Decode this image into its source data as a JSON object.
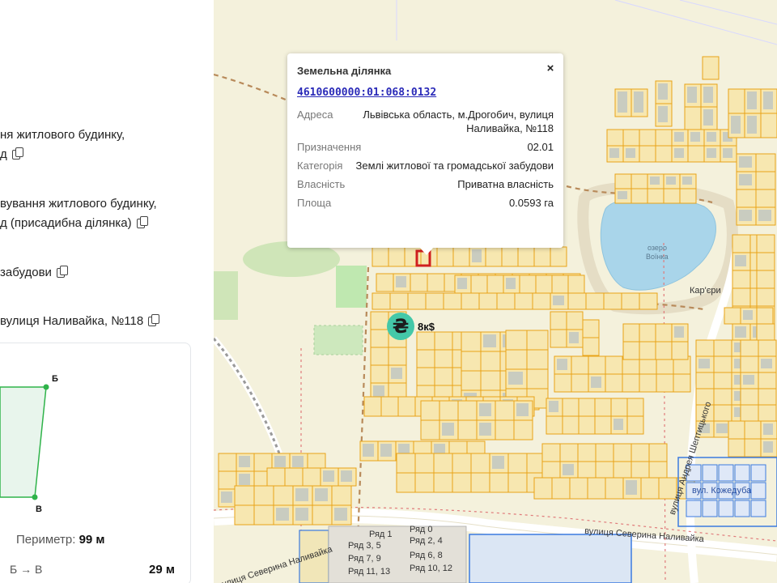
{
  "panel": {
    "line1a": "ня житлового будинку,",
    "line1b": "д",
    "line2a": "вування житлового будинку,",
    "line2b": "д (присадибна ділянка)",
    "line3": "забудови",
    "line4": " вулиця Наливайка, №118",
    "corner_b": "Б",
    "corner_v": "В",
    "perimeter_label": "Периметр:",
    "perimeter_value": "99 м",
    "segment_label": "Б → В",
    "segment_value": "29 м"
  },
  "popup": {
    "title": "Земельна ділянка",
    "close": "×",
    "cadastral": "4610600000:01:068:0132",
    "rows": [
      {
        "key": "Адреса",
        "value": "Львівська область, м.Дрогобич, вулиця Наливайка, №118"
      },
      {
        "key": "Призначення",
        "value": "02.01"
      },
      {
        "key": "Категорія",
        "value": "Землі житлової та громадської забудови"
      },
      {
        "key": "Власність",
        "value": "Приватна власність"
      },
      {
        "key": "Площа",
        "value": "0.0593 га"
      }
    ]
  },
  "pin": {
    "symbol": "₴",
    "price": "8к$"
  },
  "map_labels": {
    "lake": "озеро",
    "lake2": "Воїнка",
    "karery": "Кар'єри",
    "street1": "вулиця Северина Наливайка",
    "street2": "вулиця Северина Наливайка",
    "street3": "вулиця Андрея Шептицького",
    "rows": [
      "Ряд 0",
      "Ряд 1",
      "Ряд 2, 4",
      "Ряд 3, 5",
      "Ряд 6, 8",
      "Ряд 7, 9",
      "Ряд 10, 12",
      "Ряд 11, 13"
    ],
    "kozhedub": "вул. Кожедуба"
  },
  "colors": {
    "parcel_border": "#e8a317",
    "parcel_fill": "#f7e7b0",
    "building": "#c9ccc0",
    "water": "#a9d5ea",
    "road": "#ffffff",
    "selected": "#d01f1f",
    "pin": "#44c8a8",
    "blue_zone": "#3b7ae0"
  },
  "icons": [
    "copy-icon",
    "close-icon",
    "hryvnia-icon"
  ]
}
